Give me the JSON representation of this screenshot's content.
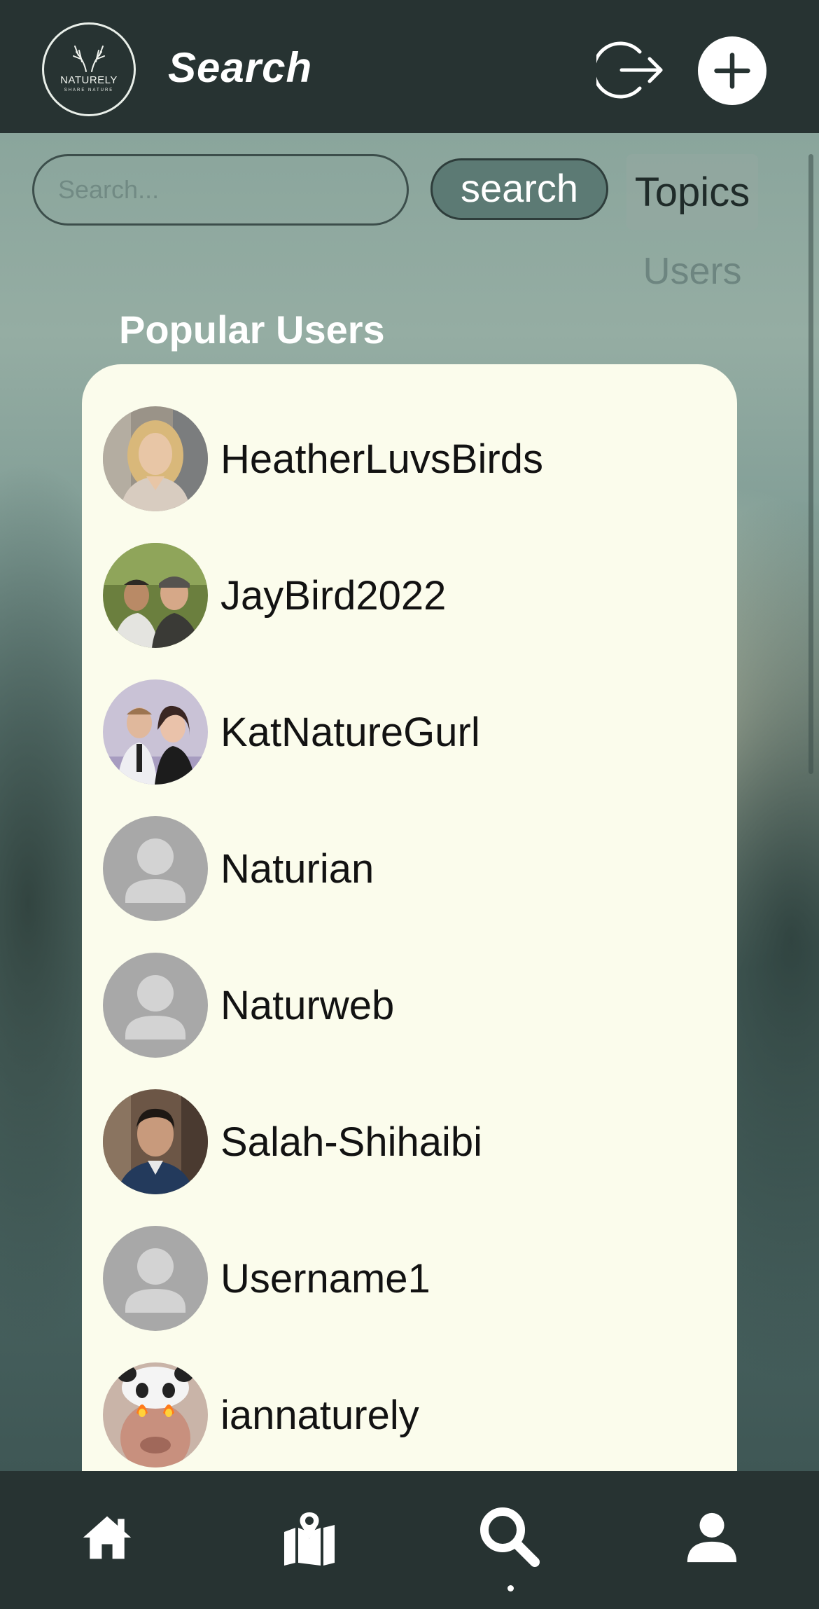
{
  "header": {
    "title": "Search",
    "logo": {
      "name": "NATURELY",
      "tagline": "SHARE NATURE"
    }
  },
  "search": {
    "placeholder": "Search...",
    "value": "",
    "button_label": "search"
  },
  "tabs": {
    "topics": "Topics",
    "users": "Users",
    "active": "topics"
  },
  "section_title": "Popular Users",
  "users": [
    {
      "username": "HeatherLuvsBirds",
      "avatar": "photo-woman-blonde"
    },
    {
      "username": "JayBird2022",
      "avatar": "photo-two-men-outdoors"
    },
    {
      "username": "KatNatureGurl",
      "avatar": "photo-couple"
    },
    {
      "username": "Naturian",
      "avatar": "default-avatar-icon"
    },
    {
      "username": "Naturweb",
      "avatar": "default-avatar-icon"
    },
    {
      "username": "Salah-Shihaibi",
      "avatar": "photo-man-portrait"
    },
    {
      "username": "Username1",
      "avatar": "default-avatar-icon"
    },
    {
      "username": "iannaturely",
      "avatar": "photo-panda-filter"
    }
  ],
  "bottom_nav": {
    "items": [
      "home-icon",
      "map-icon",
      "search-icon",
      "profile-icon"
    ],
    "active": "search-icon"
  },
  "colors": {
    "header_bg": "#273332",
    "card_bg": "#fbfcec",
    "accent_button": "#5c7a74"
  }
}
